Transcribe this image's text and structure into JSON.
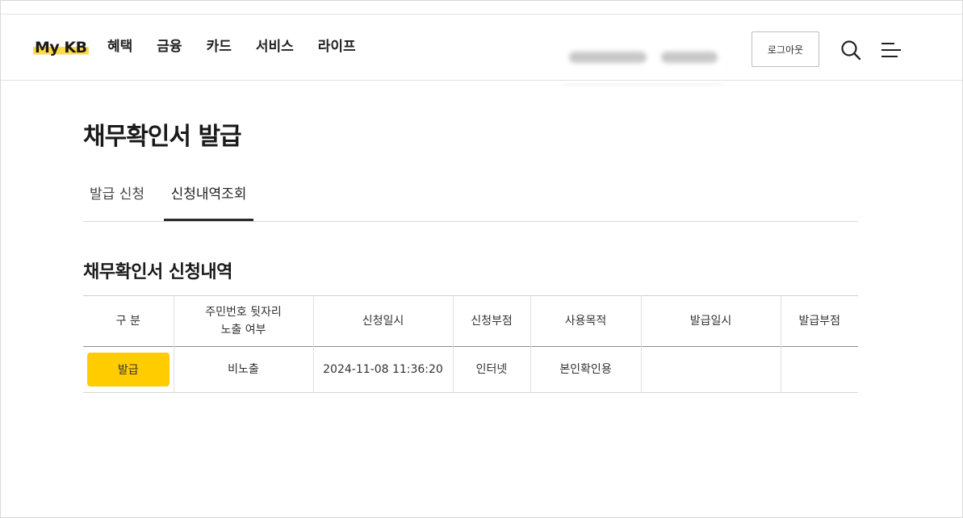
{
  "header": {
    "logo": "My KB",
    "nav": [
      "혜택",
      "금융",
      "카드",
      "서비스",
      "라이프"
    ],
    "logout_label": "로그아웃"
  },
  "page": {
    "title": "채무확인서 발급",
    "tabs": [
      {
        "label": "발급 신청",
        "active": false
      },
      {
        "label": "신청내역조회",
        "active": true
      }
    ],
    "section_title": "채무확인서 신청내역"
  },
  "table": {
    "headers": [
      "구 분",
      "주민번호 뒷자리\n노출 여부",
      "신청일시",
      "신청부점",
      "사용목적",
      "발급일시",
      "발급부점"
    ],
    "rows": [
      {
        "action_label": "발급",
        "rrn_exposure": "비노출",
        "requested_at": "2024-11-08 11:36:20",
        "branch": "인터넷",
        "purpose": "본인확인용",
        "issued_at": "",
        "issue_branch": ""
      }
    ]
  },
  "colors": {
    "accent": "#ffcc00",
    "logo_highlight": "#ffd94a"
  },
  "icons": [
    "search-icon",
    "hamburger-menu-icon"
  ]
}
